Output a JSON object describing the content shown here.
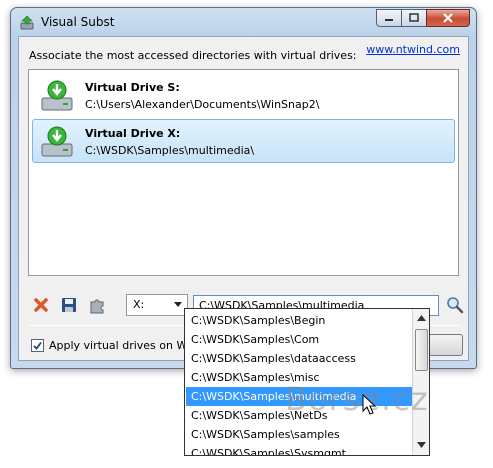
{
  "window": {
    "title": "Visual Subst"
  },
  "header": {
    "description": "Associate the most accessed directories with virtual drives:",
    "website": "www.ntwind.com"
  },
  "drives": [
    {
      "name": "Virtual Drive S:",
      "path": "C:\\Users\\Alexander\\Documents\\WinSnap2\\",
      "selected": false,
      "icon": "drive-icon"
    },
    {
      "name": "Virtual Drive X:",
      "path": "C:\\WSDK\\Samples\\multimedia\\",
      "selected": true,
      "icon": "drive-icon"
    }
  ],
  "toolbar": {
    "delete_icon": "delete-icon",
    "save_icon": "save-icon",
    "apply_icon": "apply-icon",
    "drive_letter": "X:",
    "path_value": "C:\\WSDK\\Samples\\multimedia",
    "browse_icon": "browse-icon"
  },
  "footer": {
    "apply_on_startup_label": "Apply virtual drives on Windo",
    "apply_on_startup_checked": true
  },
  "dropdown": {
    "items": [
      "C:\\WSDK\\Samples\\Begin",
      "C:\\WSDK\\Samples\\Com",
      "C:\\WSDK\\Samples\\dataaccess",
      "C:\\WSDK\\Samples\\misc",
      "C:\\WSDK\\Samples\\multimedia",
      "C:\\WSDK\\Samples\\NetDs",
      "C:\\WSDK\\Samples\\samples",
      "C:\\WSDK\\Samples\\Sysmgmt"
    ],
    "highlighted_index": 4
  },
  "watermark": "Borse.cz",
  "colors": {
    "selection": "#3399ff",
    "link": "#0033cc",
    "drive_arrow": "#2fa82f"
  }
}
